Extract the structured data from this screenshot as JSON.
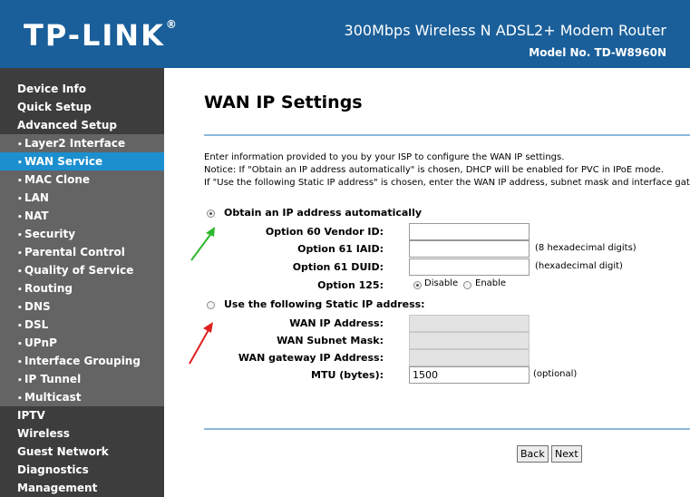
{
  "header": {
    "brand": "TP-LINK",
    "brand_mark": "®",
    "product": "300Mbps Wireless N ADSL2+ Modem Router",
    "model": "Model No. TD-W8960N",
    "bg_color": "#1a5f9a"
  },
  "sidebar": {
    "items": [
      {
        "label": "Device Info",
        "level": "main"
      },
      {
        "label": "Quick Setup",
        "level": "main"
      },
      {
        "label": "Advanced Setup",
        "level": "main"
      },
      {
        "label": "Layer2 Interface",
        "level": "sub",
        "bullet": "•"
      },
      {
        "label": "WAN Service",
        "level": "sub",
        "bullet": "•",
        "active": true
      },
      {
        "label": "MAC Clone",
        "level": "sub",
        "bullet": "•"
      },
      {
        "label": "LAN",
        "level": "sub",
        "bullet": "•"
      },
      {
        "label": "NAT",
        "level": "sub",
        "bullet": "•"
      },
      {
        "label": "Security",
        "level": "sub",
        "bullet": "•"
      },
      {
        "label": "Parental Control",
        "level": "sub",
        "bullet": "•"
      },
      {
        "label": "Quality of Service",
        "level": "sub",
        "bullet": "•"
      },
      {
        "label": "Routing",
        "level": "sub",
        "bullet": "•"
      },
      {
        "label": "DNS",
        "level": "sub",
        "bullet": "•"
      },
      {
        "label": "DSL",
        "level": "sub",
        "bullet": "•"
      },
      {
        "label": "UPnP",
        "level": "sub",
        "bullet": "•"
      },
      {
        "label": "Interface Grouping",
        "level": "sub",
        "bullet": "•"
      },
      {
        "label": "IP Tunnel",
        "level": "sub",
        "bullet": "•"
      },
      {
        "label": "Multicast",
        "level": "sub",
        "bullet": "•"
      },
      {
        "label": "IPTV",
        "level": "main"
      },
      {
        "label": "Wireless",
        "level": "main"
      },
      {
        "label": "Guest Network",
        "level": "main"
      },
      {
        "label": "Diagnostics",
        "level": "main"
      },
      {
        "label": "Management",
        "level": "main"
      }
    ],
    "active_color": "#1c8fcf"
  },
  "main": {
    "title": "WAN IP Settings",
    "intro": [
      "Enter information provided to you by your ISP to configure the WAN IP settings.",
      "Notice: If \"Obtain an IP address automatically\" is chosen, DHCP will be enabled for PVC in IPoE mode.",
      "If \"Use the following Static IP address\" is chosen, enter the WAN IP address, subnet mask and interface gatew"
    ],
    "auto_option": {
      "label": "Obtain an IP address automatically",
      "selected": true
    },
    "auto_fields": {
      "vendor_id": {
        "label": "Option 60 Vendor ID:",
        "value": ""
      },
      "iaid": {
        "label": "Option 61 IAID:",
        "value": "",
        "hint": "(8 hexadecimal digits)"
      },
      "duid": {
        "label": "Option 61 DUID:",
        "value": "",
        "hint": "(hexadecimal digit)"
      },
      "option125": {
        "label": "Option 125:",
        "choices": [
          "Disable",
          "Enable"
        ],
        "selected": "Disable"
      }
    },
    "static_option": {
      "label": "Use the following Static IP address:",
      "selected": false
    },
    "static_fields": {
      "wan_ip": {
        "label": "WAN IP Address:",
        "value": ""
      },
      "subnet": {
        "label": "WAN Subnet Mask:",
        "value": ""
      },
      "gateway": {
        "label": "WAN gateway IP Address:",
        "value": ""
      },
      "mtu": {
        "label": "MTU (bytes):",
        "value": "1500",
        "hint": "(optional)"
      }
    },
    "buttons": {
      "back": "Back",
      "next": "Next"
    },
    "annotation_colors": {
      "green_arrow": "#2db82d",
      "red_arrow": "#e02020"
    }
  }
}
